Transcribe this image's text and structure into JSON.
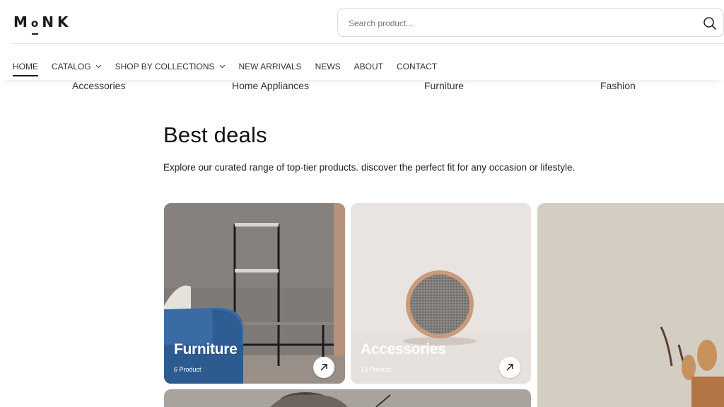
{
  "brand": {
    "logo_text_1": "M",
    "logo_text_2": "o",
    "logo_text_3": "N",
    "logo_text_4": "K"
  },
  "search": {
    "placeholder": "Search product..."
  },
  "nav": {
    "items": [
      {
        "label": "HOME"
      },
      {
        "label": "CATALOG"
      },
      {
        "label": "SHOP BY COLLECTIONS"
      },
      {
        "label": "NEW ARRIVALS"
      },
      {
        "label": "NEWS"
      },
      {
        "label": "ABOUT"
      },
      {
        "label": "CONTACT"
      }
    ]
  },
  "categories": [
    "Accessories",
    "Home Appliances",
    "Furniture",
    "Fashion"
  ],
  "section": {
    "title": "Best deals",
    "subtitle": "Explore our curated range of top-tier products. discover the perfect fit for any occasion or lifestyle."
  },
  "cards": [
    {
      "name": "Furniture",
      "count": "6 Product"
    },
    {
      "name": "Accessories",
      "count": "13 Product"
    }
  ],
  "icons": {
    "search": "search-icon",
    "chevron": "chevron-down-icon",
    "arrow": "arrow-up-right-icon"
  }
}
